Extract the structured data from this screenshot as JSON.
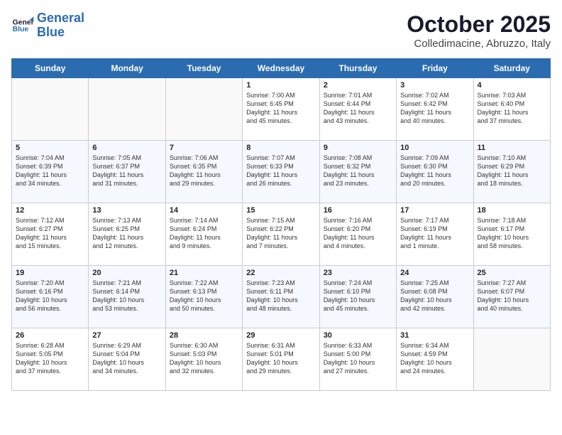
{
  "header": {
    "logo_line1": "General",
    "logo_line2": "Blue",
    "month": "October 2025",
    "location": "Colledimacine, Abruzzo, Italy"
  },
  "days_of_week": [
    "Sunday",
    "Monday",
    "Tuesday",
    "Wednesday",
    "Thursday",
    "Friday",
    "Saturday"
  ],
  "weeks": [
    [
      {
        "day": "",
        "lines": []
      },
      {
        "day": "",
        "lines": []
      },
      {
        "day": "",
        "lines": []
      },
      {
        "day": "1",
        "lines": [
          "Sunrise: 7:00 AM",
          "Sunset: 6:45 PM",
          "Daylight: 11 hours",
          "and 45 minutes."
        ]
      },
      {
        "day": "2",
        "lines": [
          "Sunrise: 7:01 AM",
          "Sunset: 6:44 PM",
          "Daylight: 11 hours",
          "and 43 minutes."
        ]
      },
      {
        "day": "3",
        "lines": [
          "Sunrise: 7:02 AM",
          "Sunset: 6:42 PM",
          "Daylight: 11 hours",
          "and 40 minutes."
        ]
      },
      {
        "day": "4",
        "lines": [
          "Sunrise: 7:03 AM",
          "Sunset: 6:40 PM",
          "Daylight: 11 hours",
          "and 37 minutes."
        ]
      }
    ],
    [
      {
        "day": "5",
        "lines": [
          "Sunrise: 7:04 AM",
          "Sunset: 6:39 PM",
          "Daylight: 11 hours",
          "and 34 minutes."
        ]
      },
      {
        "day": "6",
        "lines": [
          "Sunrise: 7:05 AM",
          "Sunset: 6:37 PM",
          "Daylight: 11 hours",
          "and 31 minutes."
        ]
      },
      {
        "day": "7",
        "lines": [
          "Sunrise: 7:06 AM",
          "Sunset: 6:35 PM",
          "Daylight: 11 hours",
          "and 29 minutes."
        ]
      },
      {
        "day": "8",
        "lines": [
          "Sunrise: 7:07 AM",
          "Sunset: 6:33 PM",
          "Daylight: 11 hours",
          "and 26 minutes."
        ]
      },
      {
        "day": "9",
        "lines": [
          "Sunrise: 7:08 AM",
          "Sunset: 6:32 PM",
          "Daylight: 11 hours",
          "and 23 minutes."
        ]
      },
      {
        "day": "10",
        "lines": [
          "Sunrise: 7:09 AM",
          "Sunset: 6:30 PM",
          "Daylight: 11 hours",
          "and 20 minutes."
        ]
      },
      {
        "day": "11",
        "lines": [
          "Sunrise: 7:10 AM",
          "Sunset: 6:29 PM",
          "Daylight: 11 hours",
          "and 18 minutes."
        ]
      }
    ],
    [
      {
        "day": "12",
        "lines": [
          "Sunrise: 7:12 AM",
          "Sunset: 6:27 PM",
          "Daylight: 11 hours",
          "and 15 minutes."
        ]
      },
      {
        "day": "13",
        "lines": [
          "Sunrise: 7:13 AM",
          "Sunset: 6:25 PM",
          "Daylight: 11 hours",
          "and 12 minutes."
        ]
      },
      {
        "day": "14",
        "lines": [
          "Sunrise: 7:14 AM",
          "Sunset: 6:24 PM",
          "Daylight: 11 hours",
          "and 9 minutes."
        ]
      },
      {
        "day": "15",
        "lines": [
          "Sunrise: 7:15 AM",
          "Sunset: 6:22 PM",
          "Daylight: 11 hours",
          "and 7 minutes."
        ]
      },
      {
        "day": "16",
        "lines": [
          "Sunrise: 7:16 AM",
          "Sunset: 6:20 PM",
          "Daylight: 11 hours",
          "and 4 minutes."
        ]
      },
      {
        "day": "17",
        "lines": [
          "Sunrise: 7:17 AM",
          "Sunset: 6:19 PM",
          "Daylight: 11 hours",
          "and 1 minute."
        ]
      },
      {
        "day": "18",
        "lines": [
          "Sunrise: 7:18 AM",
          "Sunset: 6:17 PM",
          "Daylight: 10 hours",
          "and 58 minutes."
        ]
      }
    ],
    [
      {
        "day": "19",
        "lines": [
          "Sunrise: 7:20 AM",
          "Sunset: 6:16 PM",
          "Daylight: 10 hours",
          "and 56 minutes."
        ]
      },
      {
        "day": "20",
        "lines": [
          "Sunrise: 7:21 AM",
          "Sunset: 6:14 PM",
          "Daylight: 10 hours",
          "and 53 minutes."
        ]
      },
      {
        "day": "21",
        "lines": [
          "Sunrise: 7:22 AM",
          "Sunset: 6:13 PM",
          "Daylight: 10 hours",
          "and 50 minutes."
        ]
      },
      {
        "day": "22",
        "lines": [
          "Sunrise: 7:23 AM",
          "Sunset: 6:11 PM",
          "Daylight: 10 hours",
          "and 48 minutes."
        ]
      },
      {
        "day": "23",
        "lines": [
          "Sunrise: 7:24 AM",
          "Sunset: 6:10 PM",
          "Daylight: 10 hours",
          "and 45 minutes."
        ]
      },
      {
        "day": "24",
        "lines": [
          "Sunrise: 7:25 AM",
          "Sunset: 6:08 PM",
          "Daylight: 10 hours",
          "and 42 minutes."
        ]
      },
      {
        "day": "25",
        "lines": [
          "Sunrise: 7:27 AM",
          "Sunset: 6:07 PM",
          "Daylight: 10 hours",
          "and 40 minutes."
        ]
      }
    ],
    [
      {
        "day": "26",
        "lines": [
          "Sunrise: 6:28 AM",
          "Sunset: 5:05 PM",
          "Daylight: 10 hours",
          "and 37 minutes."
        ]
      },
      {
        "day": "27",
        "lines": [
          "Sunrise: 6:29 AM",
          "Sunset: 5:04 PM",
          "Daylight: 10 hours",
          "and 34 minutes."
        ]
      },
      {
        "day": "28",
        "lines": [
          "Sunrise: 6:30 AM",
          "Sunset: 5:03 PM",
          "Daylight: 10 hours",
          "and 32 minutes."
        ]
      },
      {
        "day": "29",
        "lines": [
          "Sunrise: 6:31 AM",
          "Sunset: 5:01 PM",
          "Daylight: 10 hours",
          "and 29 minutes."
        ]
      },
      {
        "day": "30",
        "lines": [
          "Sunrise: 6:33 AM",
          "Sunset: 5:00 PM",
          "Daylight: 10 hours",
          "and 27 minutes."
        ]
      },
      {
        "day": "31",
        "lines": [
          "Sunrise: 6:34 AM",
          "Sunset: 4:59 PM",
          "Daylight: 10 hours",
          "and 24 minutes."
        ]
      },
      {
        "day": "",
        "lines": []
      }
    ]
  ]
}
